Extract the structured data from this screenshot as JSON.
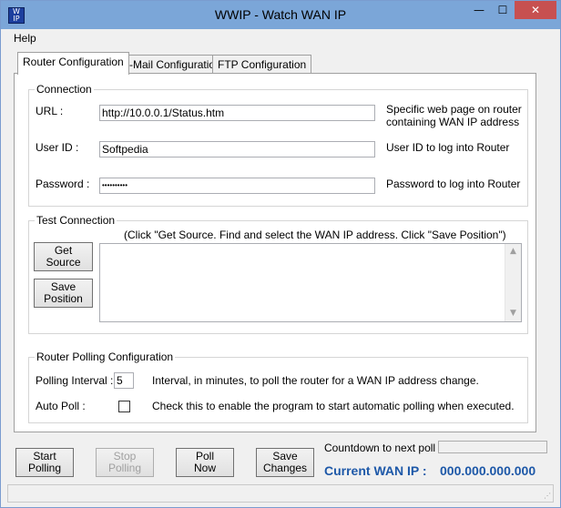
{
  "window": {
    "title": "WWIP - Watch WAN IP",
    "icon_text": "W\nIP",
    "minimize_glyph": "—",
    "maximize_glyph": "☐",
    "close_glyph": "✕"
  },
  "menu": {
    "help": "Help"
  },
  "tabs": [
    {
      "label": "Router Configuration",
      "active": true
    },
    {
      "label": "E-Mail Configuration",
      "active": false
    },
    {
      "label": "FTP Configuration",
      "active": false
    }
  ],
  "connection": {
    "legend": "Connection",
    "url_label": "URL :",
    "url_value": "http://10.0.0.1/Status.htm",
    "url_help_1": "Specific web page on router",
    "url_help_2": "containing WAN IP address",
    "userid_label": "User ID :",
    "userid_value": "Softpedia",
    "userid_help": "User ID to log into Router",
    "password_label": "Password :",
    "password_value": "••••••••••",
    "password_help": "Password to log into Router"
  },
  "test": {
    "legend": "Test Connection",
    "instructions": "(Click \"Get Source. Find and select the WAN IP address. Click \"Save Position\")",
    "get_source": "Get\nSource",
    "save_position": "Save\nPosition",
    "source_text": "",
    "scroll_up": "▲",
    "scroll_down": "▼"
  },
  "polling": {
    "legend": "Router Polling Configuration",
    "interval_label": "Polling Interval :",
    "interval_value": "5",
    "interval_help": "Interval, in minutes, to poll the router for a WAN IP address change.",
    "autopoll_label": "Auto Poll :",
    "autopoll_checked": false,
    "autopoll_help": "Check this to enable the program to start automatic polling when executed."
  },
  "buttons": {
    "start": "Start\nPolling",
    "stop": "Stop\nPolling",
    "poll_now": "Poll\nNow",
    "save_changes": "Save\nChanges"
  },
  "status": {
    "countdown_label": "Countdown to next poll :",
    "current_ip_label": "Current WAN IP :",
    "current_ip_value": "000.000.000.000",
    "grip": "⋰"
  },
  "colors": {
    "accent": "#1d58a8",
    "titlebar": "#7ba6d8",
    "close": "#c75050"
  }
}
